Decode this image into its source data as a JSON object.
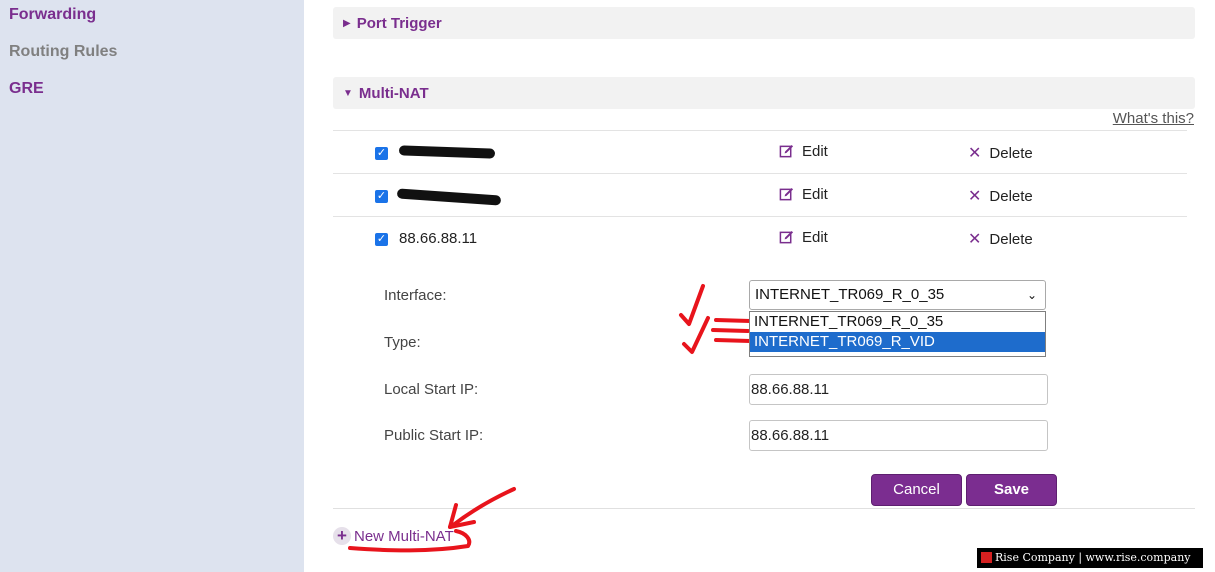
{
  "sidebar": {
    "items": [
      {
        "label": "Forwarding"
      },
      {
        "label": "Routing Rules"
      },
      {
        "label": "GRE"
      }
    ]
  },
  "sections": {
    "port_trigger": {
      "title": "Port Trigger",
      "state": "collapsed"
    },
    "multi_nat": {
      "title": "Multi-NAT",
      "state": "expanded"
    }
  },
  "help_link": "What's this?",
  "rows": [
    {
      "ip": "",
      "checked": true,
      "edit": "Edit",
      "delete": "Delete"
    },
    {
      "ip": "",
      "checked": true,
      "edit": "Edit",
      "delete": "Delete"
    },
    {
      "ip": "88.66.88.11",
      "checked": true,
      "edit": "Edit",
      "delete": "Delete"
    }
  ],
  "form": {
    "interface_label": "Interface:",
    "interface_value": "INTERNET_TR069_R_0_35",
    "interface_options": [
      "INTERNET_TR069_R_0_35",
      "INTERNET_TR069_R_VID"
    ],
    "highlighted_option": "INTERNET_TR069_R_VID",
    "type_label": "Type:",
    "local_start_ip_label": "Local Start IP:",
    "local_start_ip_value": "88.66.88.11",
    "public_start_ip_label": "Public Start IP:",
    "public_start_ip_value": "88.66.88.11",
    "cancel_label": "Cancel",
    "save_label": "Save"
  },
  "new_multi_nat_label": "New Multi-NAT",
  "watermark": "Rise Company | www.rise.company",
  "colors": {
    "brand_purple": "#7a2e8e",
    "button_purple": "#7b2d90",
    "sidebar_bg": "#dde3ef",
    "highlight_blue": "#1e6ccc",
    "annotation_red": "#e8141c"
  },
  "icons": {
    "edit": "pencil-square-icon",
    "delete": "x-icon",
    "add": "plus-circle-icon"
  }
}
